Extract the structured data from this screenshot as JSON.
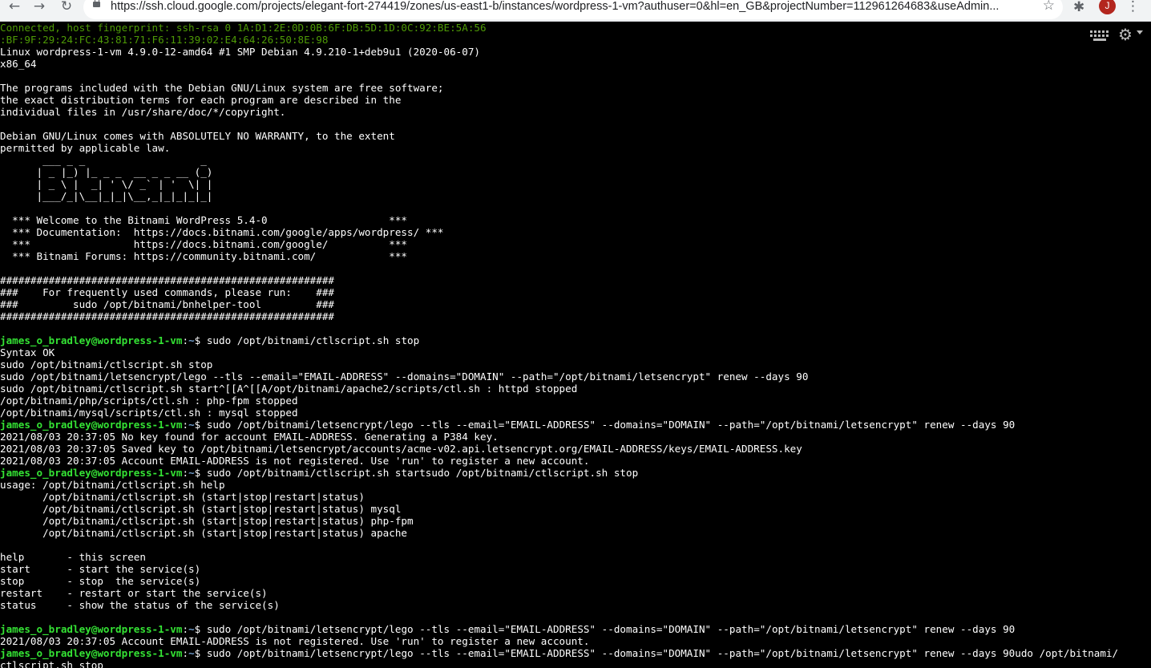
{
  "browser": {
    "back_icon": "←",
    "forward_icon": "→",
    "reload_icon": "↻",
    "url": "https://ssh.cloud.google.com/projects/elegant-fort-274419/zones/us-east1-b/instances/wordpress-1-vm?authuser=0&hl=en_GB&projectNumber=112961264683&useAdmin...",
    "star_icon": "☆",
    "extensions_icon": "✱",
    "avatar_letter": "J",
    "menu_icon": "⋮"
  },
  "terminal": {
    "gear_icon": "⚙",
    "prompt_user": "james_o_bradley@wordpress-1-vm",
    "prompt_path": "~",
    "prompt_symbol": "$ ",
    "lines": [
      {
        "t": "t",
        "s": "Connected, host fingerprint: ssh-rsa 0 1A:D1:2E:0D:0B:6F:DB:5D:1D:0C:92:BE:5A:56"
      },
      {
        "t": "t",
        "s": ":BF:9F:29:24:FC:43:81:71:F6:11:39:02:E4:64:26:50:8E:98"
      },
      {
        "t": "o",
        "s": "Linux wordpress-1-vm 4.9.0-12-amd64 #1 SMP Debian 4.9.210-1+deb9u1 (2020-06-07)"
      },
      {
        "t": "o",
        "s": "x86_64"
      },
      {
        "t": "o",
        "s": ""
      },
      {
        "t": "o",
        "s": "The programs included with the Debian GNU/Linux system are free software;"
      },
      {
        "t": "o",
        "s": "the exact distribution terms for each program are described in the"
      },
      {
        "t": "o",
        "s": "individual files in /usr/share/doc/*/copyright."
      },
      {
        "t": "o",
        "s": ""
      },
      {
        "t": "o",
        "s": "Debian GNU/Linux comes with ABSOLUTELY NO WARRANTY, to the extent"
      },
      {
        "t": "o",
        "s": "permitted by applicable law."
      },
      {
        "t": "o",
        "s": "       ___ _ _                   _"
      },
      {
        "t": "o",
        "s": "      | _ |_) |_ _ _  __ _ _ __ (_)"
      },
      {
        "t": "o",
        "s": "      | _ \\ |  _| ' \\/ _` | '  \\| |"
      },
      {
        "t": "o",
        "s": "      |___/_|\\__|_|_|\\__,_|_|_|_|_|"
      },
      {
        "t": "o",
        "s": ""
      },
      {
        "t": "o",
        "s": "  *** Welcome to the Bitnami WordPress 5.4-0                    ***"
      },
      {
        "t": "o",
        "s": "  *** Documentation:  https://docs.bitnami.com/google/apps/wordpress/ ***"
      },
      {
        "t": "o",
        "s": "  ***                 https://docs.bitnami.com/google/          ***"
      },
      {
        "t": "o",
        "s": "  *** Bitnami Forums: https://community.bitnami.com/            ***"
      },
      {
        "t": "o",
        "s": ""
      },
      {
        "t": "o",
        "s": "#######################################################"
      },
      {
        "t": "o",
        "s": "###    For frequently used commands, please run:    ###"
      },
      {
        "t": "o",
        "s": "###         sudo /opt/bitnami/bnhelper-tool         ###"
      },
      {
        "t": "o",
        "s": "#######################################################"
      },
      {
        "t": "o",
        "s": ""
      },
      {
        "t": "p",
        "s": "sudo /opt/bitnami/ctlscript.sh stop"
      },
      {
        "t": "o",
        "s": "Syntax OK"
      },
      {
        "t": "o",
        "s": "sudo /opt/bitnami/ctlscript.sh stop"
      },
      {
        "t": "o",
        "s": "sudo /opt/bitnami/letsencrypt/lego --tls --email=\"EMAIL-ADDRESS\" --domains=\"DOMAIN\" --path=\"/opt/bitnami/letsencrypt\" renew --days 90"
      },
      {
        "t": "o",
        "s": "sudo /opt/bitnami/ctlscript.sh start^[[A^[[A/opt/bitnami/apache2/scripts/ctl.sh : httpd stopped"
      },
      {
        "t": "o",
        "s": "/opt/bitnami/php/scripts/ctl.sh : php-fpm stopped"
      },
      {
        "t": "o",
        "s": "/opt/bitnami/mysql/scripts/ctl.sh : mysql stopped"
      },
      {
        "t": "p",
        "s": "sudo /opt/bitnami/letsencrypt/lego --tls --email=\"EMAIL-ADDRESS\" --domains=\"DOMAIN\" --path=\"/opt/bitnami/letsencrypt\" renew --days 90"
      },
      {
        "t": "o",
        "s": "2021/08/03 20:37:05 No key found for account EMAIL-ADDRESS. Generating a P384 key."
      },
      {
        "t": "o",
        "s": "2021/08/03 20:37:05 Saved key to /opt/bitnami/letsencrypt/accounts/acme-v02.api.letsencrypt.org/EMAIL-ADDRESS/keys/EMAIL-ADDRESS.key"
      },
      {
        "t": "o",
        "s": "2021/08/03 20:37:05 Account EMAIL-ADDRESS is not registered. Use 'run' to register a new account."
      },
      {
        "t": "p",
        "s": "sudo /opt/bitnami/ctlscript.sh startsudo /opt/bitnami/ctlscript.sh stop"
      },
      {
        "t": "o",
        "s": "usage: /opt/bitnami/ctlscript.sh help"
      },
      {
        "t": "o",
        "s": "       /opt/bitnami/ctlscript.sh (start|stop|restart|status)"
      },
      {
        "t": "o",
        "s": "       /opt/bitnami/ctlscript.sh (start|stop|restart|status) mysql"
      },
      {
        "t": "o",
        "s": "       /opt/bitnami/ctlscript.sh (start|stop|restart|status) php-fpm"
      },
      {
        "t": "o",
        "s": "       /opt/bitnami/ctlscript.sh (start|stop|restart|status) apache"
      },
      {
        "t": "o",
        "s": ""
      },
      {
        "t": "o",
        "s": "help       - this screen"
      },
      {
        "t": "o",
        "s": "start      - start the service(s)"
      },
      {
        "t": "o",
        "s": "stop       - stop  the service(s)"
      },
      {
        "t": "o",
        "s": "restart    - restart or start the service(s)"
      },
      {
        "t": "o",
        "s": "status     - show the status of the service(s)"
      },
      {
        "t": "o",
        "s": ""
      },
      {
        "t": "p",
        "s": "sudo /opt/bitnami/letsencrypt/lego --tls --email=\"EMAIL-ADDRESS\" --domains=\"DOMAIN\" --path=\"/opt/bitnami/letsencrypt\" renew --days 90"
      },
      {
        "t": "o",
        "s": "2021/08/03 20:37:05 Account EMAIL-ADDRESS is not registered. Use 'run' to register a new account."
      },
      {
        "t": "p",
        "s": "sudo /opt/bitnami/letsencrypt/lego --tls --email=\"EMAIL-ADDRESS\" --domains=\"DOMAIN\" --path=\"/opt/bitnami/letsencrypt\" renew --days 90udo /opt/bitnami/"
      },
      {
        "t": "o",
        "s": "ctlscript.sh stop"
      }
    ]
  }
}
